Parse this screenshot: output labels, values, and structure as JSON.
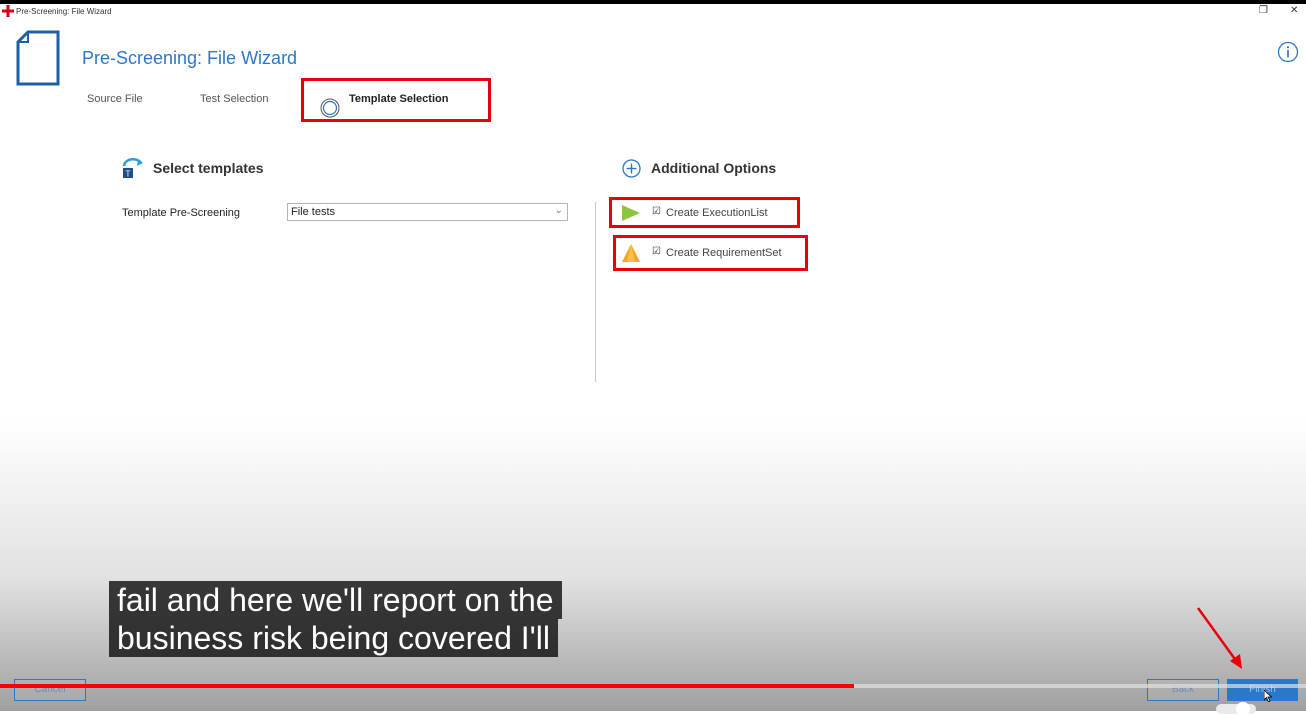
{
  "window": {
    "title": "Pre-Screening: File Wizard",
    "controls": [
      "restore-icon",
      "close-icon"
    ]
  },
  "header": {
    "title": "Pre-Screening: File Wizard",
    "icons": [
      "document-icon",
      "info-icon"
    ]
  },
  "steps": [
    {
      "label": "Source File",
      "active": false
    },
    {
      "label": "Test Selection",
      "active": false
    },
    {
      "label": "Template Selection",
      "active": true
    }
  ],
  "select_templates": {
    "heading": "Select templates",
    "field_label": "Template Pre-Screening",
    "selected_value": "File tests"
  },
  "additional_options": {
    "heading": "Additional Options",
    "options": [
      {
        "label": "Create ExecutionList",
        "checked": true,
        "icon": "execution-list-icon"
      },
      {
        "label": "Create RequirementSet",
        "checked": true,
        "icon": "requirement-set-icon"
      }
    ]
  },
  "caption": {
    "line1": "fail and here we'll report on the",
    "line2": "business risk being covered I'll"
  },
  "video": {
    "progress": 0.654
  },
  "footer": {
    "cancel_label": "Cancel",
    "back_label": "Back",
    "finish_label": "Finish"
  },
  "colors": {
    "accent": "#2a78c8",
    "highlight": "#e8000b",
    "progress": "#ff0000"
  }
}
